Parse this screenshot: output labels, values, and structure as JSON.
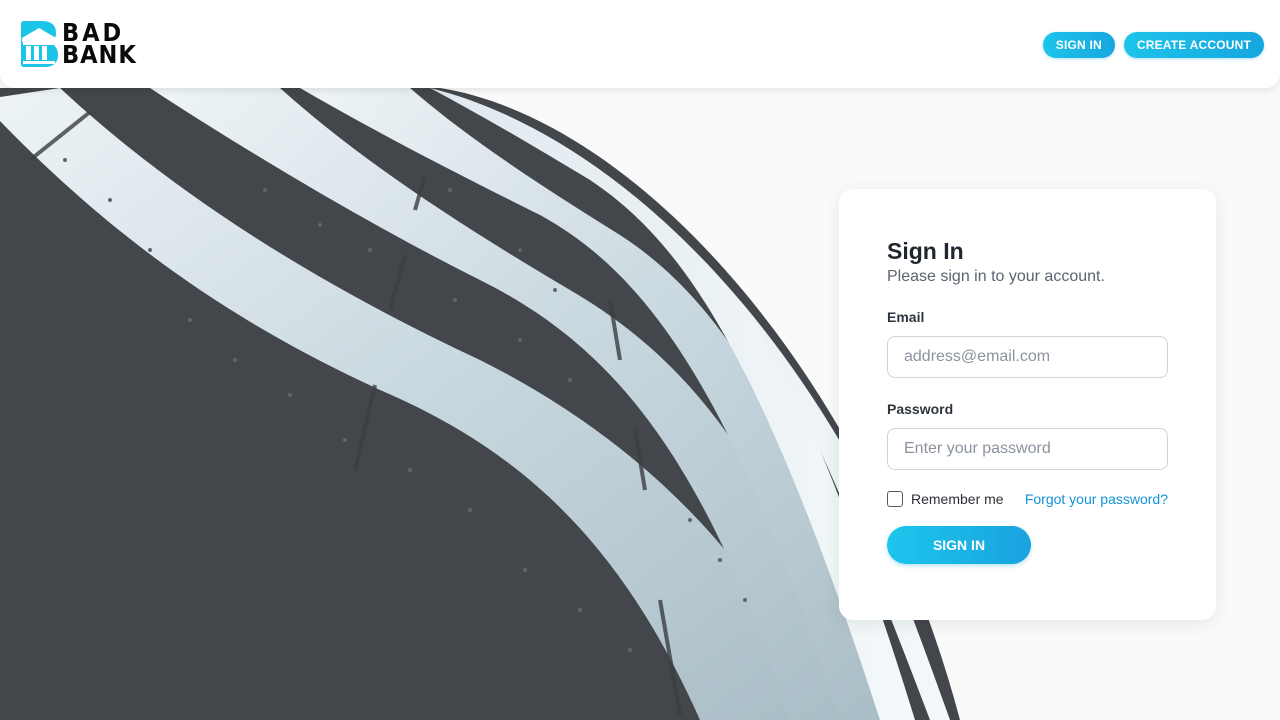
{
  "brand": {
    "line1": "BAD",
    "line2": "BANK",
    "accent": "#1cc4ea"
  },
  "nav": {
    "signin_label": "SIGN IN",
    "create_label": "CREATE ACCOUNT"
  },
  "signin_card": {
    "title": "Sign In",
    "subtitle": "Please sign in to your account.",
    "email_label": "Email",
    "email_placeholder": "address@email.com",
    "email_value": "",
    "password_label": "Password",
    "password_placeholder": "Enter your password",
    "password_value": "",
    "remember_label": "Remember me",
    "remember_checked": false,
    "forgot_label": "Forgot your password?",
    "submit_label": "SIGN IN"
  },
  "colors": {
    "primary": "#1cc4ea",
    "primary_dark": "#17a6e0",
    "link": "#1293d6",
    "background_dark": "#43474b",
    "page_background": "#fafafa"
  },
  "icons": {
    "logo": "bank-building-logo-icon"
  }
}
